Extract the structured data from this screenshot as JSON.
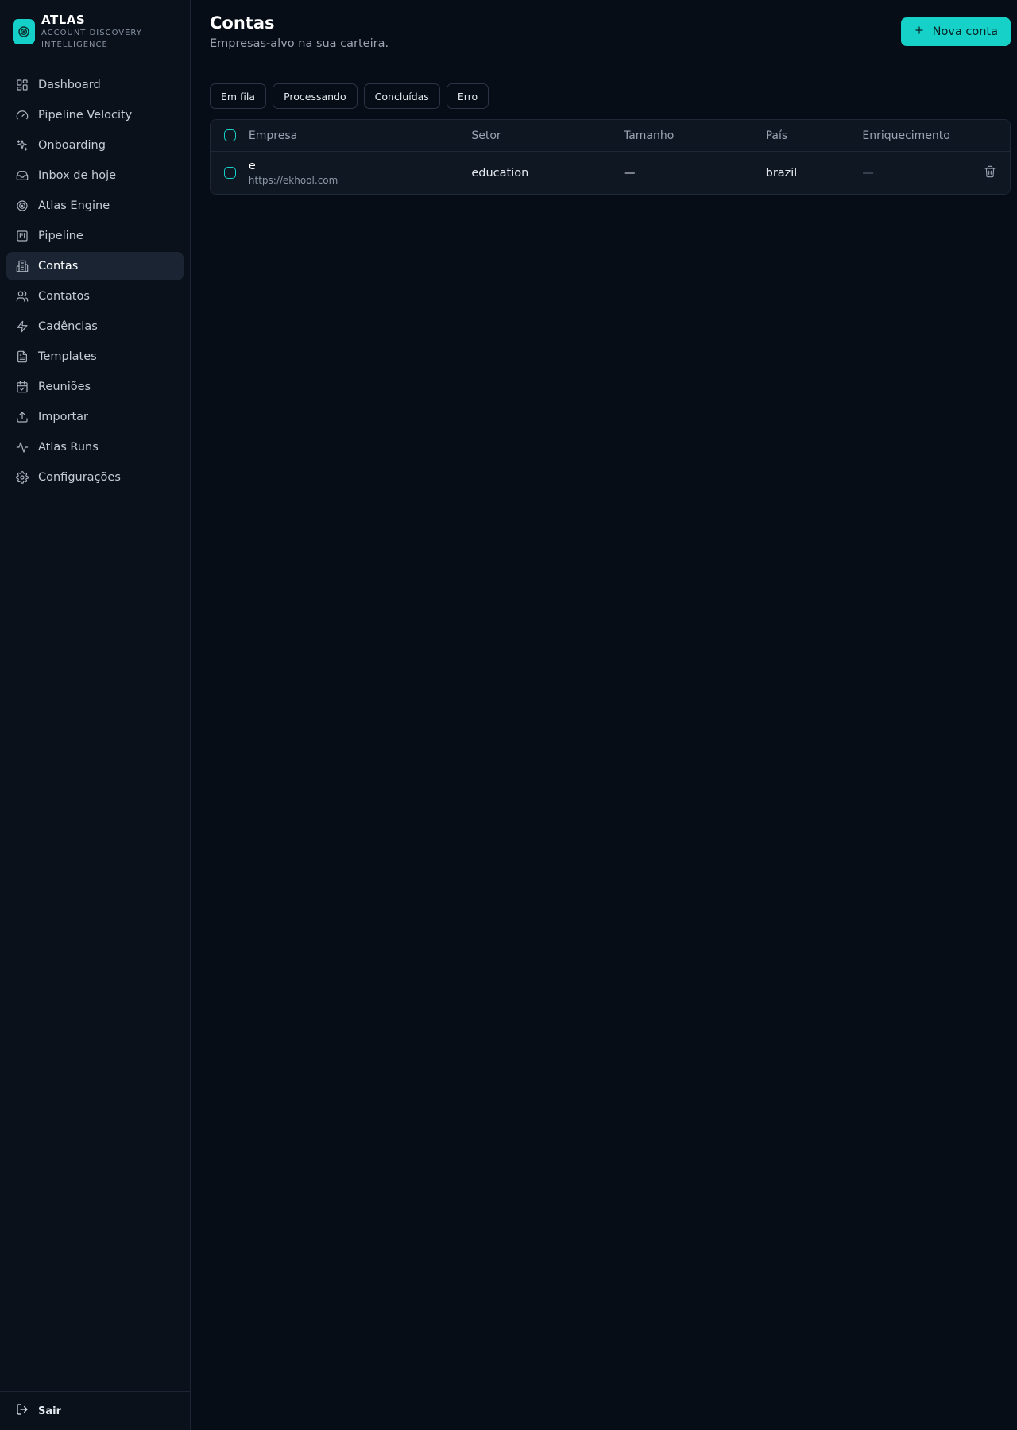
{
  "brand": {
    "title": "ATLAS",
    "subtitle": "ACCOUNT DISCOVERY INTELLIGENCE",
    "accent": "#16d1c8"
  },
  "sidebar": {
    "items": [
      {
        "label": "Dashboard",
        "icon": "grid-icon"
      },
      {
        "label": "Pipeline Velocity",
        "icon": "gauge-icon"
      },
      {
        "label": "Onboarding",
        "icon": "sparkles-icon"
      },
      {
        "label": "Inbox de hoje",
        "icon": "inbox-icon"
      },
      {
        "label": "Atlas Engine",
        "icon": "target-icon"
      },
      {
        "label": "Pipeline",
        "icon": "kanban-icon"
      },
      {
        "label": "Contas",
        "icon": "building-icon",
        "active": true
      },
      {
        "label": "Contatos",
        "icon": "users-icon"
      },
      {
        "label": "Cadências",
        "icon": "zap-icon"
      },
      {
        "label": "Templates",
        "icon": "file-text-icon"
      },
      {
        "label": "Reuniões",
        "icon": "calendar-check-icon"
      },
      {
        "label": "Importar",
        "icon": "upload-icon"
      },
      {
        "label": "Atlas Runs",
        "icon": "activity-icon"
      },
      {
        "label": "Configurações",
        "icon": "gear-icon"
      }
    ],
    "logout_label": "Sair"
  },
  "header": {
    "title": "Contas",
    "subtitle": "Empresas-alvo na sua carteira.",
    "new_button_label": "Nova conta"
  },
  "filters": [
    "Em fila",
    "Processando",
    "Concluídas",
    "Erro"
  ],
  "table": {
    "columns": [
      "Empresa",
      "Setor",
      "Tamanho",
      "País",
      "Enriquecimento"
    ],
    "rows": [
      {
        "empresa": "e",
        "url": "https://ekhool.com",
        "setor": "education",
        "tamanho": "—",
        "pais": "brazil",
        "enriquecimento": "—"
      }
    ]
  }
}
